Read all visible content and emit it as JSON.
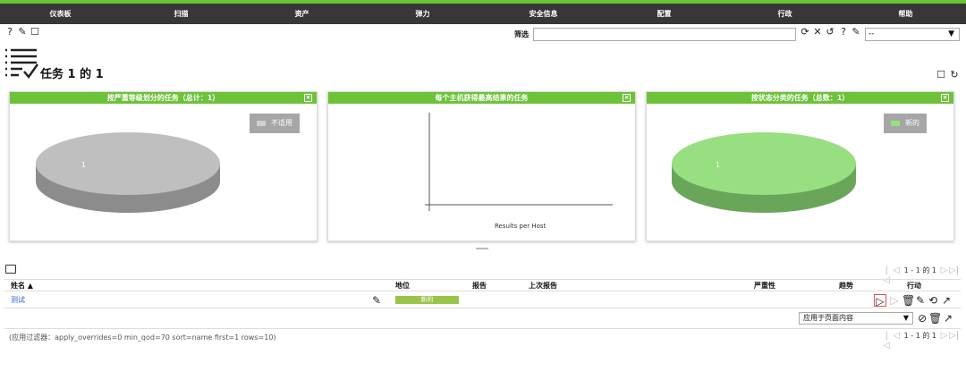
{
  "nav": {
    "items": [
      "仪表板",
      "扫描",
      "资产",
      "弹力",
      "安全信息",
      "配置",
      "行政",
      "帮助"
    ]
  },
  "toolbar": {
    "filter_label": "筛选",
    "filter_value": "",
    "select_value": "--"
  },
  "page": {
    "title": "任务 1 的 1"
  },
  "charts": [
    {
      "title": "按严重等级划分的任务（总计：1）",
      "legend": "不适用",
      "legend_color": "#bdbdbd",
      "slice_label": "1"
    },
    {
      "title": "每个主机获得最高结果的任务",
      "xlabel": "Results per Host"
    },
    {
      "title": "按状态分类的任务（总数：1）",
      "legend": "新的",
      "legend_color": "#98df82",
      "slice_label": "1"
    }
  ],
  "chart_data": [
    {
      "type": "pie",
      "title": "按严重等级划分的任务（总计：1）",
      "categories": [
        "不适用"
      ],
      "values": [
        1
      ],
      "colors": [
        "#bdbdbd"
      ],
      "legend": "top-right"
    },
    {
      "type": "bar",
      "title": "每个主机获得最高结果的任务",
      "xlabel": "Results per Host",
      "categories": [],
      "values": []
    },
    {
      "type": "pie",
      "title": "按状态分类的任务（总数：1）",
      "categories": [
        "新的"
      ],
      "values": [
        1
      ],
      "colors": [
        "#98df82"
      ],
      "legend": "top-right"
    }
  ],
  "pager": {
    "text": "1 - 1 的 1"
  },
  "table": {
    "headers": {
      "name": "姓名 ▲",
      "status": "地位",
      "reports": "报告",
      "last_report": "上次报告",
      "severity": "严重性",
      "trend": "趋势",
      "actions": "行动"
    },
    "rows": [
      {
        "name": "测试",
        "status": "新的"
      }
    ]
  },
  "bulk": {
    "select_value": "应用于页面内容"
  },
  "filter_applied": "(应用过滤器：apply_overrides=0 min_qod=70 sort=name first=1 rows=10)"
}
